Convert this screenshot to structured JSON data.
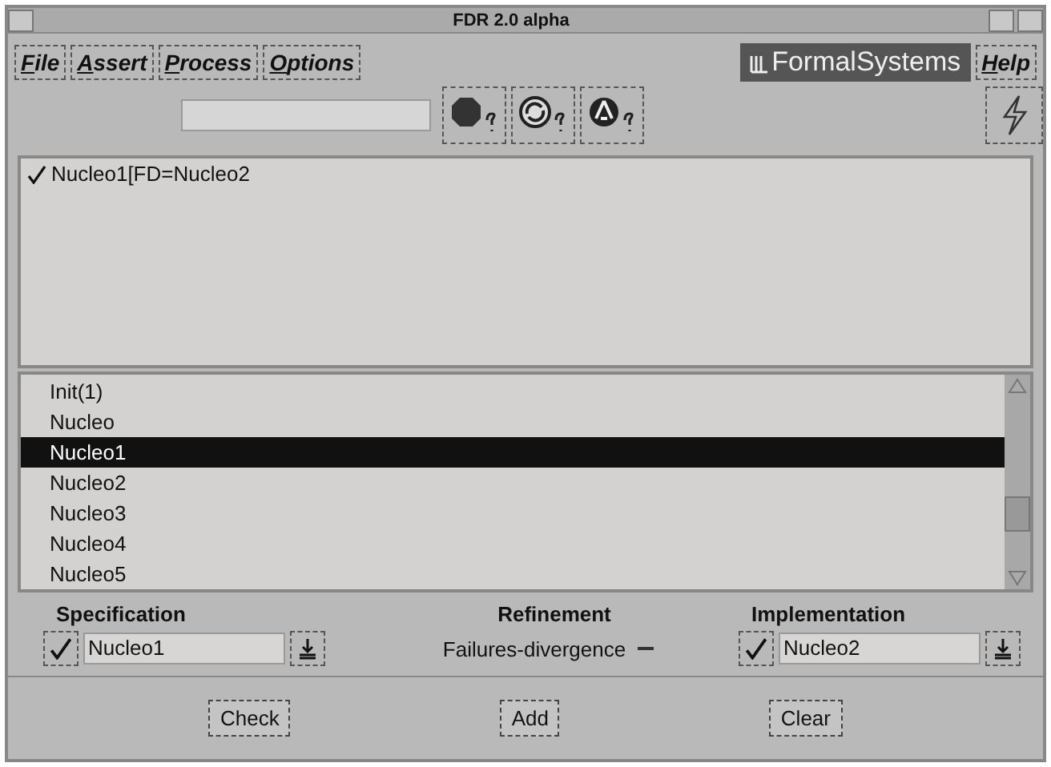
{
  "window": {
    "title": "FDR 2.0 alpha"
  },
  "menus": [
    {
      "label": "File"
    },
    {
      "label": "Assert"
    },
    {
      "label": "Process"
    },
    {
      "label": "Options"
    }
  ],
  "logo": "FormalSystems",
  "help_menu": "Help",
  "assertions": [
    {
      "text": "Nucleo1[FD=Nucleo2",
      "checked": true
    }
  ],
  "processes": [
    {
      "label": "Init(1)",
      "selected": false
    },
    {
      "label": "Nucleo",
      "selected": false
    },
    {
      "label": "Nucleo1",
      "selected": true
    },
    {
      "label": "Nucleo2",
      "selected": false
    },
    {
      "label": "Nucleo3",
      "selected": false
    },
    {
      "label": "Nucleo4",
      "selected": false
    },
    {
      "label": "Nucleo5",
      "selected": false
    }
  ],
  "specification": {
    "label": "Specification",
    "value": "Nucleo1"
  },
  "refinement": {
    "label": "Refinement",
    "value": "Failures-divergence"
  },
  "implementation": {
    "label": "Implementation",
    "value": "Nucleo2"
  },
  "buttons": [
    "Check",
    "Add",
    "Clear"
  ]
}
